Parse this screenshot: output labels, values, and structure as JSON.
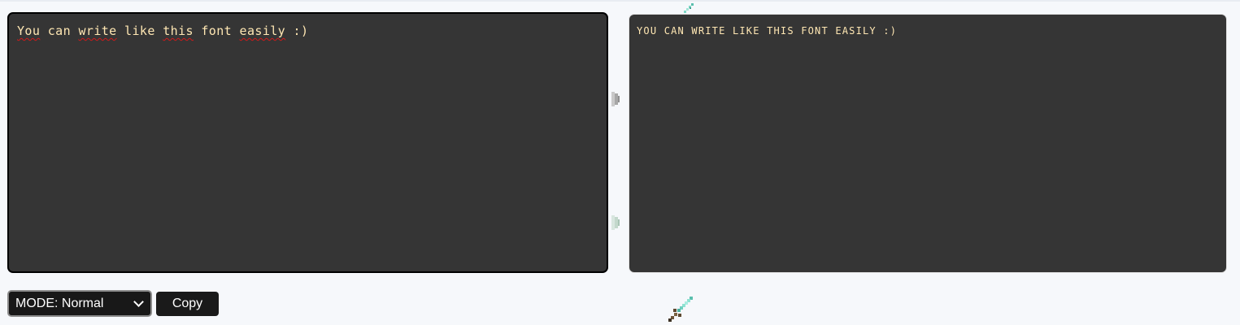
{
  "editor": {
    "parts": [
      "You",
      " can ",
      "write",
      " like ",
      "this",
      " font ",
      "easily",
      " :)"
    ]
  },
  "output": {
    "text": "YOU CAN WRITE LIKE THIS FONT EASILY :)"
  },
  "controls": {
    "mode_label": "MODE: Normal",
    "copy_label": "Copy"
  },
  "decorations": {
    "icons": [
      "sword-icon",
      "sword-icon",
      "shield-icon",
      "shield-icon"
    ]
  },
  "colors": {
    "page_background": "#f6f8fb",
    "panel_background": "#353535",
    "text_color": "#ffe7b3",
    "spellcheck_underline": "#d11a1a",
    "button_background": "#1a1a1a"
  }
}
